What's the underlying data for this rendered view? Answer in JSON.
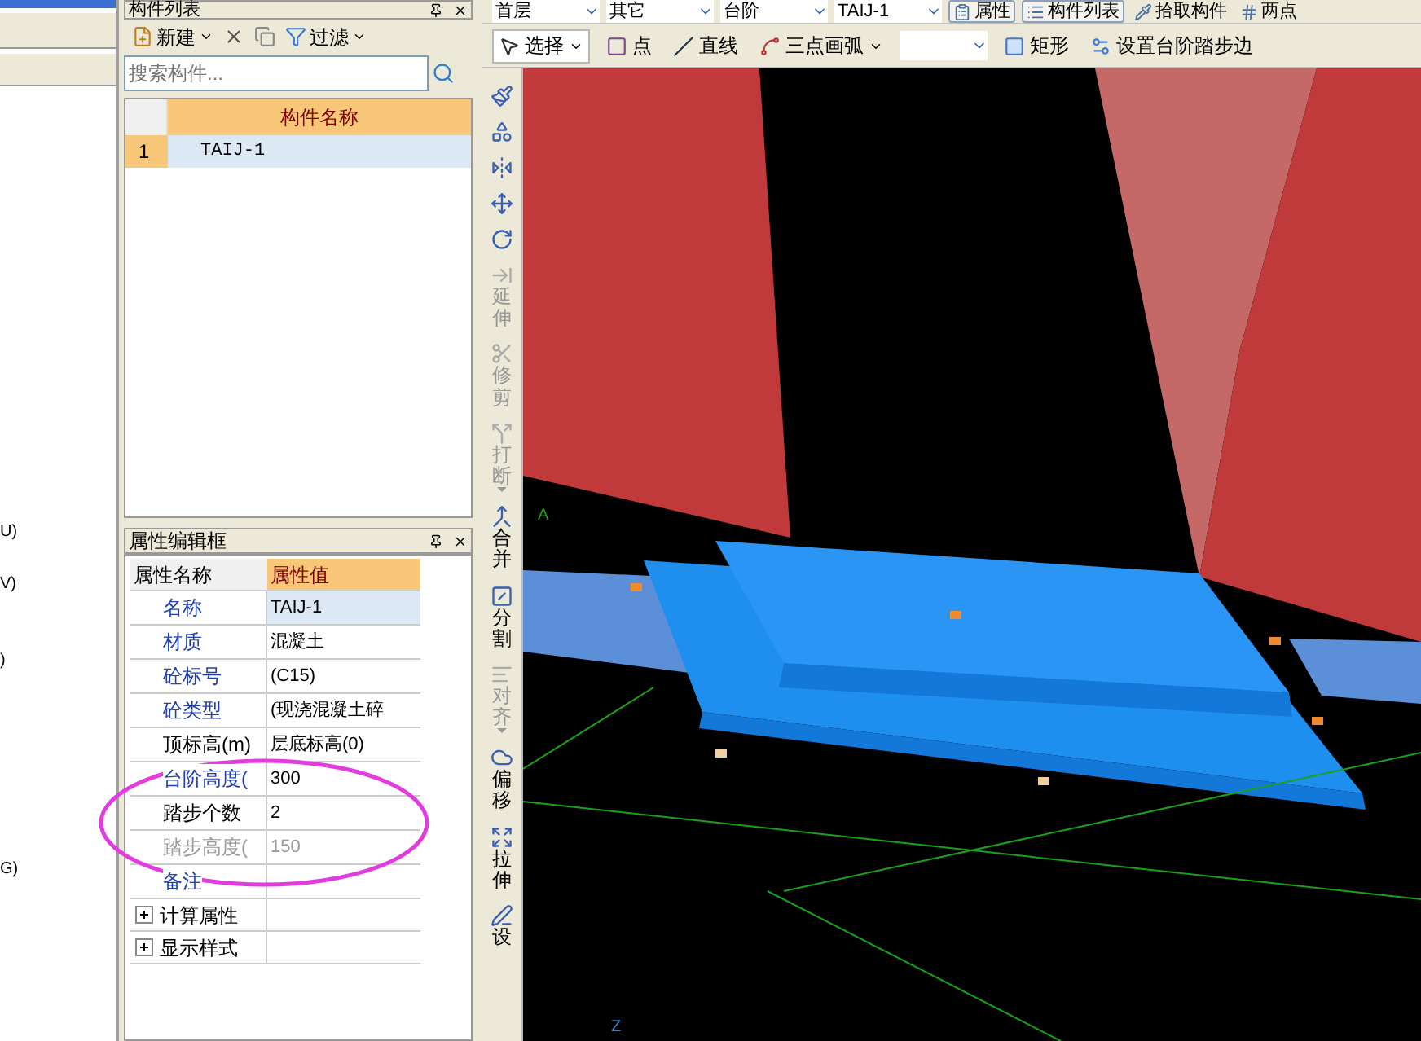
{
  "left_panel": {
    "lines": [
      "U)",
      "V)",
      ")",
      "G)"
    ]
  },
  "component_list": {
    "title": "构件列表",
    "toolbar": [
      {
        "kind": "new",
        "label": "新建",
        "dropdown": true
      },
      {
        "kind": "delete",
        "dropdown": false
      },
      {
        "kind": "copy",
        "dropdown": false
      },
      {
        "kind": "filter",
        "label": "过滤",
        "dropdown": true
      }
    ],
    "search": {
      "placeholder": "搜索构件..."
    },
    "columns": [
      "构件名称"
    ],
    "rows": [
      {
        "index": "1",
        "name": "TAIJ-1",
        "selected": true
      }
    ]
  },
  "property_editor": {
    "title": "属性编辑框",
    "columns": [
      "属性名称",
      "属性值"
    ],
    "rows": [
      {
        "name": "名称",
        "value": "TAIJ-1",
        "kind": "public",
        "selected": true
      },
      {
        "name": "材质",
        "value": "混凝土",
        "kind": "public",
        "selected": false
      },
      {
        "name": "砼标号",
        "value": "(C15)",
        "kind": "public",
        "selected": false
      },
      {
        "name": "砼类型",
        "value": "(现浇混凝土碎",
        "kind": "public",
        "selected": false
      },
      {
        "name": "顶标高(m)",
        "value": "层底标高(0)",
        "kind": "private",
        "selected": false
      },
      {
        "name": "台阶高度(",
        "value": "300",
        "kind": "public",
        "selected": false
      },
      {
        "name": "踏步个数",
        "value": "2",
        "kind": "private",
        "selected": false
      },
      {
        "name": "踏步高度(",
        "value": "150",
        "kind": "disabled",
        "selected": false
      },
      {
        "name": "备注",
        "value": "",
        "kind": "public",
        "selected": false
      }
    ],
    "groups": [
      {
        "label": "计算属性",
        "expanded": false
      },
      {
        "label": "显示样式",
        "expanded": false
      }
    ]
  },
  "top_toolbar": {
    "selectors": [
      "首层",
      "其它",
      "台阶",
      "TAIJ-1"
    ],
    "buttons": [
      {
        "label": "属性",
        "selected": true
      },
      {
        "label": "构件列表",
        "selected": true
      },
      {
        "label": "拾取构件",
        "selected": false
      },
      {
        "label": "两点",
        "selected": false
      }
    ]
  },
  "draw_toolbar": {
    "items": [
      {
        "kind": "select",
        "label": "选择",
        "dropdown": true
      },
      {
        "kind": "point",
        "label": "点",
        "dropdown": false
      },
      {
        "kind": "line",
        "label": "直线",
        "dropdown": false
      },
      {
        "kind": "arc",
        "label": "三点画弧",
        "dropdown": true
      },
      {
        "kind": "combo",
        "dropdown": true
      },
      {
        "kind": "rect",
        "label": "矩形",
        "dropdown": false
      },
      {
        "kind": "steps",
        "label": "设置台阶踏步边",
        "dropdown": false
      }
    ]
  },
  "side_toolbar": {
    "items": [
      {
        "disabled": false,
        "dropdown": false
      },
      {
        "disabled": false,
        "dropdown": false
      },
      {
        "disabled": false,
        "dropdown": false
      },
      {
        "disabled": false,
        "dropdown": false
      },
      {
        "disabled": false,
        "dropdown": false
      },
      {
        "label": "延伸",
        "disabled": true,
        "dropdown": false
      },
      {
        "label": "修剪",
        "disabled": true,
        "dropdown": false
      },
      {
        "label": "打断",
        "disabled": true,
        "dropdown": true
      },
      {
        "label": "合并",
        "disabled": false,
        "dropdown": false
      },
      {
        "label": "分割",
        "disabled": false,
        "dropdown": false
      },
      {
        "label": "对齐",
        "disabled": true,
        "dropdown": true
      },
      {
        "label": "偏移",
        "disabled": false,
        "dropdown": false
      },
      {
        "label": "拉伸",
        "disabled": false,
        "dropdown": false
      },
      {
        "label": "设",
        "disabled": false,
        "dropdown": false
      }
    ]
  },
  "viewport": {
    "axis_label": "A",
    "corner_label": "Z"
  }
}
